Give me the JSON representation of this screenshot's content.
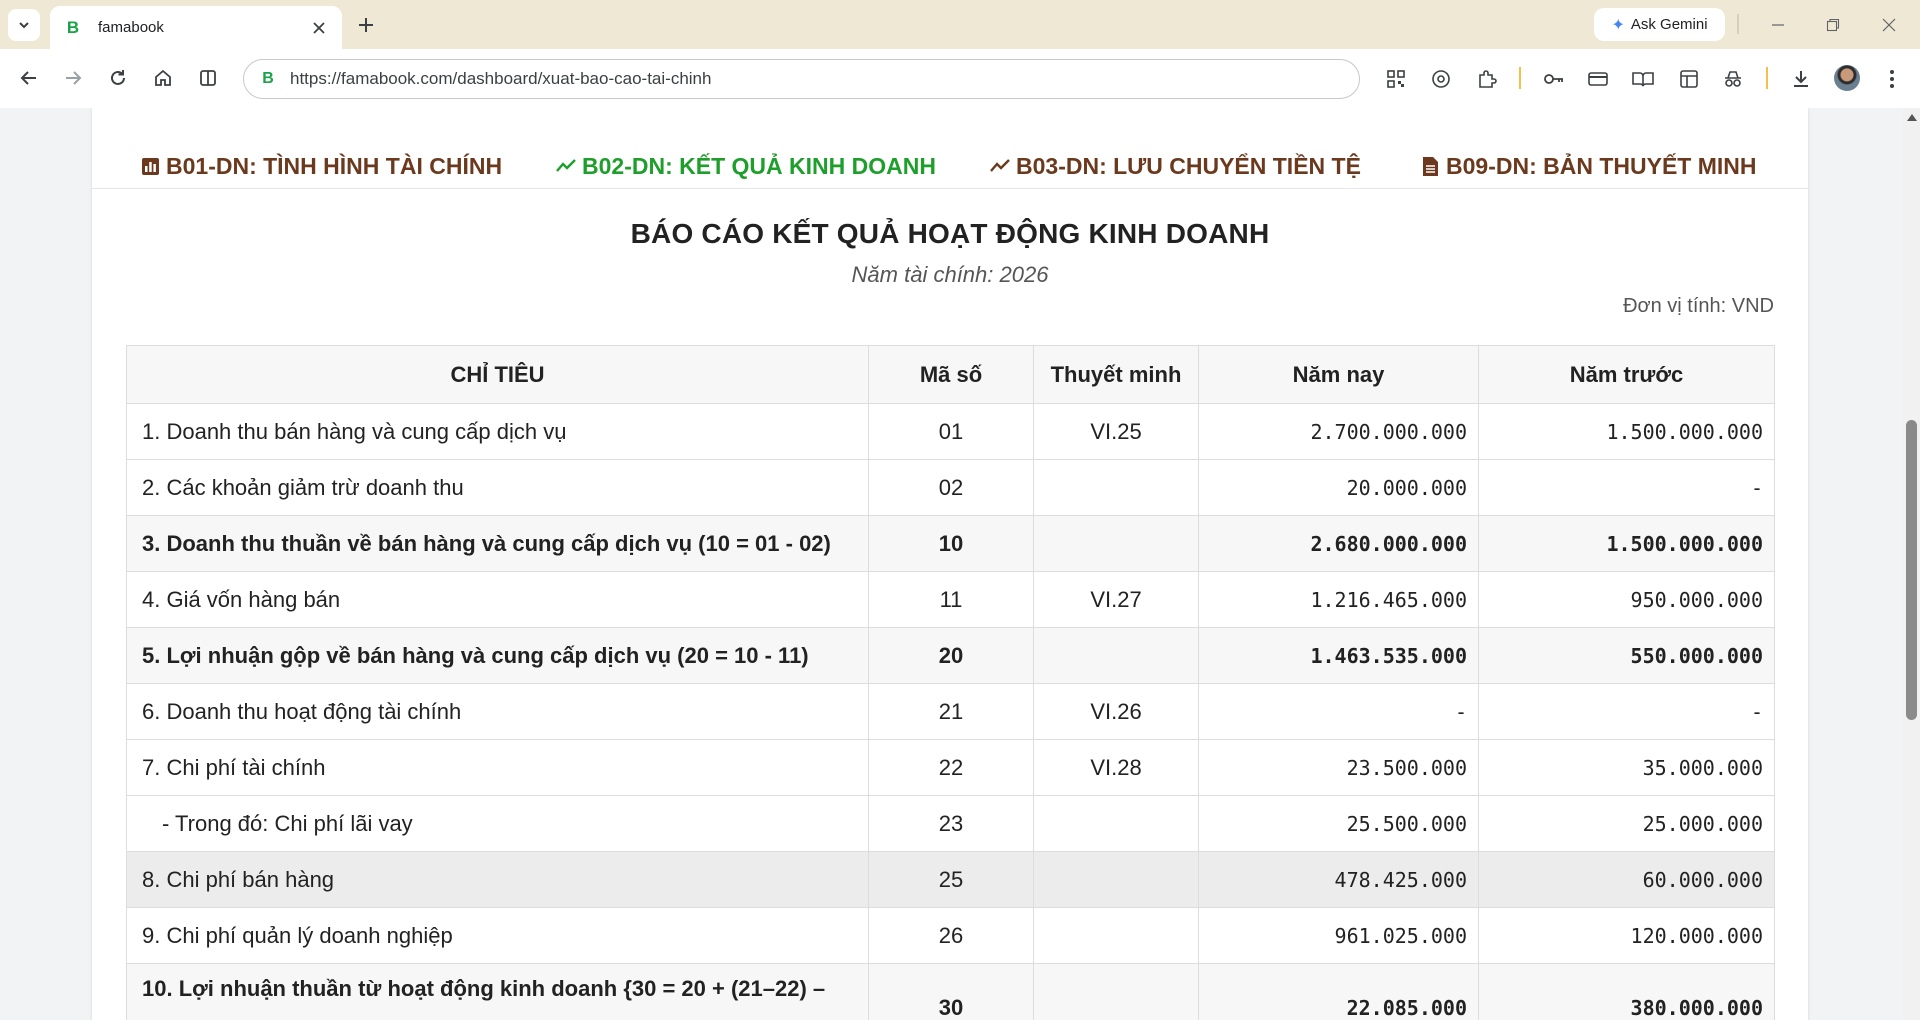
{
  "browser": {
    "tab_title": "famabook",
    "favicon_letter": "B",
    "url": "https://famabook.com/dashboard/xuat-bao-cao-tai-chinh",
    "gemini_label": "Ask Gemini"
  },
  "report_tabs": [
    {
      "label": "B01-DN: TÌNH HÌNH TÀI CHÍNH",
      "icon": "bar-chart-icon",
      "active": false
    },
    {
      "label": "B02-DN: KẾT QUẢ KINH DOANH",
      "icon": "line-chart-icon",
      "active": true
    },
    {
      "label": "B03-DN: LƯU CHUYỂN TIỀN TỆ",
      "icon": "line-chart-icon",
      "active": false
    },
    {
      "label": "B09-DN: BẢN THUYẾT MINH",
      "icon": "document-icon",
      "active": false
    }
  ],
  "report": {
    "title": "BÁO CÁO KẾT QUẢ HOẠT ĐỘNG KINH DOANH",
    "subtitle": "Năm tài chính: 2026",
    "unit": "Đơn vị tính: VND"
  },
  "table": {
    "headers": [
      "CHỈ TIÊU",
      "Mã số",
      "Thuyết minh",
      "Năm nay",
      "Năm trước"
    ],
    "rows": [
      {
        "name": "1. Doanh thu bán hàng và cung cấp dịch vụ",
        "code": "01",
        "note": "VI.25",
        "current": "2.700.000.000",
        "previous": "1.500.000.000"
      },
      {
        "name": "2. Các khoản giảm trừ doanh thu",
        "code": "02",
        "note": "",
        "current": "20.000.000",
        "previous": "-"
      },
      {
        "name": "3. Doanh thu thuần về bán hàng và cung cấp dịch vụ (10 = 01 - 02)",
        "code": "10",
        "note": "",
        "current": "2.680.000.000",
        "previous": "1.500.000.000"
      },
      {
        "name": "4. Giá vốn hàng bán",
        "code": "11",
        "note": "VI.27",
        "current": "1.216.465.000",
        "previous": "950.000.000"
      },
      {
        "name": "5. Lợi nhuận gộp về bán hàng và cung cấp dịch vụ (20 = 10 - 11)",
        "code": "20",
        "note": "",
        "current": "1.463.535.000",
        "previous": "550.000.000"
      },
      {
        "name": "6. Doanh thu hoạt động tài chính",
        "code": "21",
        "note": "VI.26",
        "current": "-",
        "previous": "-"
      },
      {
        "name": "7. Chi phí tài chính",
        "code": "22",
        "note": "VI.28",
        "current": "23.500.000",
        "previous": "35.000.000"
      },
      {
        "name": "- Trong đó: Chi phí lãi vay",
        "code": "23",
        "note": "",
        "current": "25.500.000",
        "previous": "25.000.000"
      },
      {
        "name": "8. Chi phí bán hàng",
        "code": "25",
        "note": "",
        "current": "478.425.000",
        "previous": "60.000.000"
      },
      {
        "name": "9. Chi phí quản lý doanh nghiệp",
        "code": "26",
        "note": "",
        "current": "961.025.000",
        "previous": "120.000.000"
      },
      {
        "name": "10. Lợi nhuận thuần từ hoạt động kinh doanh {30 = 20 + (21–22) –",
        "code": "30",
        "note": "",
        "current": "22.085.000",
        "previous": "380.000.000"
      }
    ]
  }
}
